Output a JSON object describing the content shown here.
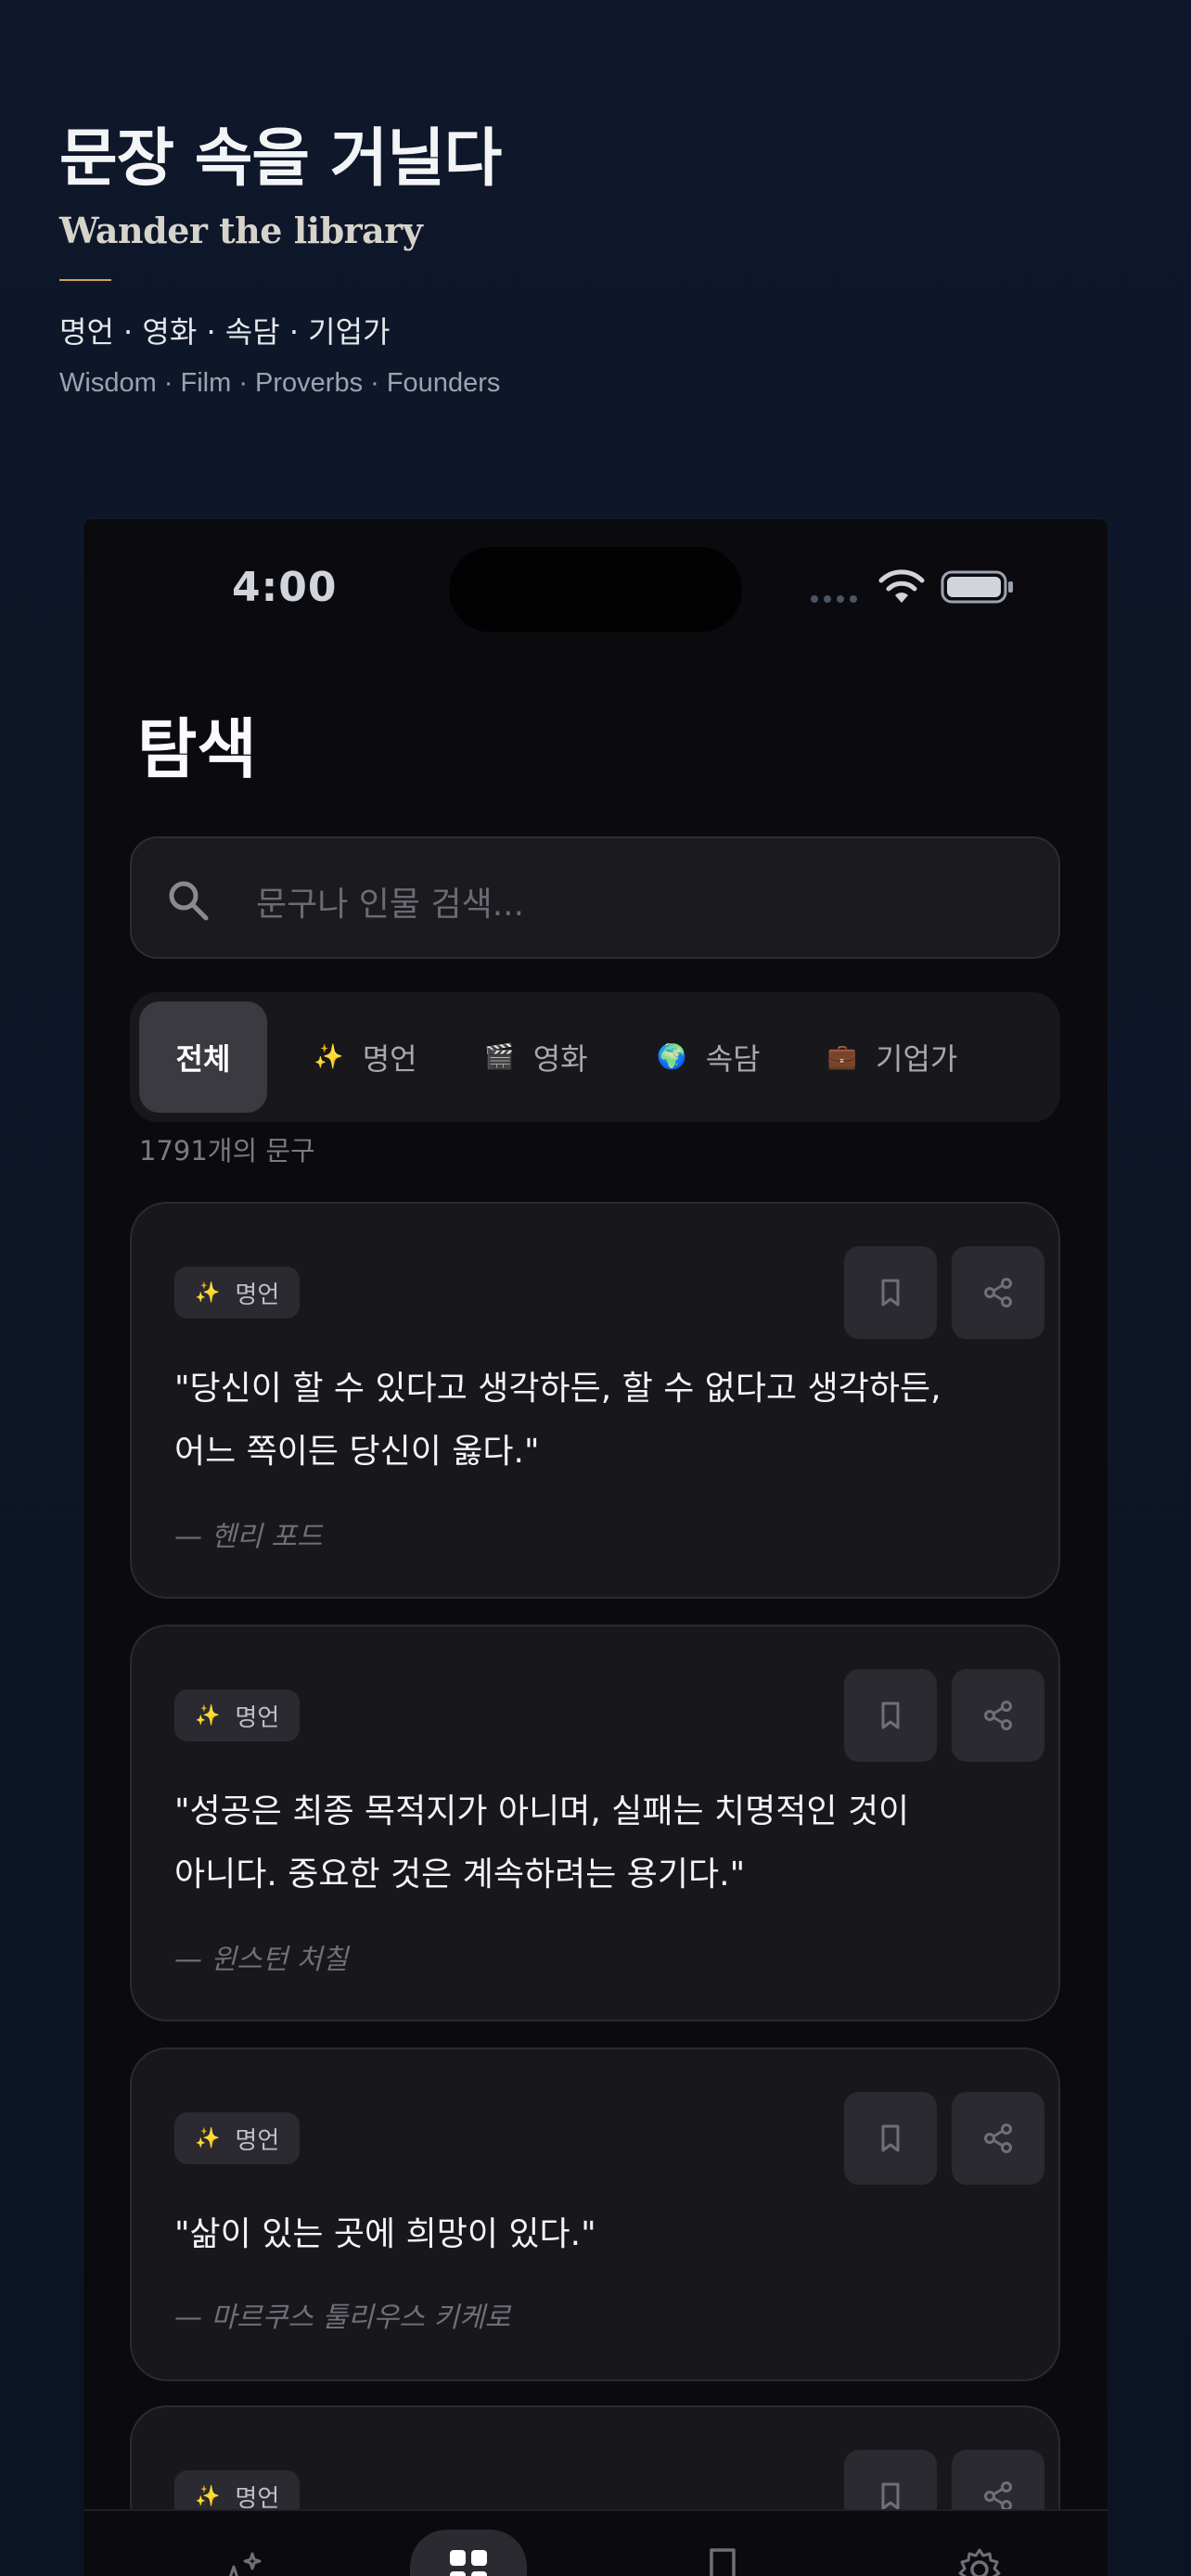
{
  "promo": {
    "title": "문장 속을 거닐다",
    "subtitle": "Wander the library",
    "categories_ko": "명언 · 영화 · 속담 · 기업가",
    "categories_en": "Wisdom · Film · Proverbs · Founders"
  },
  "status": {
    "time": "4:00"
  },
  "screen": {
    "title": "탐색",
    "search_placeholder": "문구나 인물 검색...",
    "count": "1791개의 문구"
  },
  "filters": [
    {
      "label": "전체",
      "emoji": "",
      "active": true
    },
    {
      "label": "명언",
      "emoji": "✨",
      "active": false
    },
    {
      "label": "영화",
      "emoji": "🎬",
      "active": false
    },
    {
      "label": "속담",
      "emoji": "🌍",
      "active": false
    },
    {
      "label": "기업가",
      "emoji": "💼",
      "active": false
    }
  ],
  "cards": [
    {
      "category_emoji": "✨",
      "category": "명언",
      "quote_line1": "\"당신이 할 수 있다고 생각하든, 할 수 없다고 생각하든,",
      "quote_line2": "어느 쪽이든 당신이 옳다.\"",
      "author": "— 헨리 포드"
    },
    {
      "category_emoji": "✨",
      "category": "명언",
      "quote_line1": "\"성공은 최종 목적지가 아니며, 실패는 치명적인 것이",
      "quote_line2": "아니다. 중요한 것은 계속하려는 용기다.\"",
      "author": "— 윈스턴 처칠"
    },
    {
      "category_emoji": "✨",
      "category": "명언",
      "quote_line1": "\"삶이 있는 곳에 희망이 있다.\"",
      "quote_line2": "",
      "author": "— 마르쿠스 툴리우스 키케로"
    },
    {
      "category_emoji": "✨",
      "category": "명언",
      "quote_line1": "",
      "quote_line2": "",
      "author": ""
    }
  ],
  "icons": {
    "search": "search-icon",
    "bookmark": "bookmark-icon",
    "share": "share-icon",
    "wifi": "wifi-icon",
    "battery": "battery-icon",
    "tab_discover": "sparkles-icon",
    "tab_browse": "grid-icon",
    "tab_saved": "bookmark-icon",
    "tab_settings": "gear-icon"
  },
  "colors": {
    "accent_gold": "#c9a45c",
    "background": "#0f172a",
    "card": "#18181c"
  }
}
